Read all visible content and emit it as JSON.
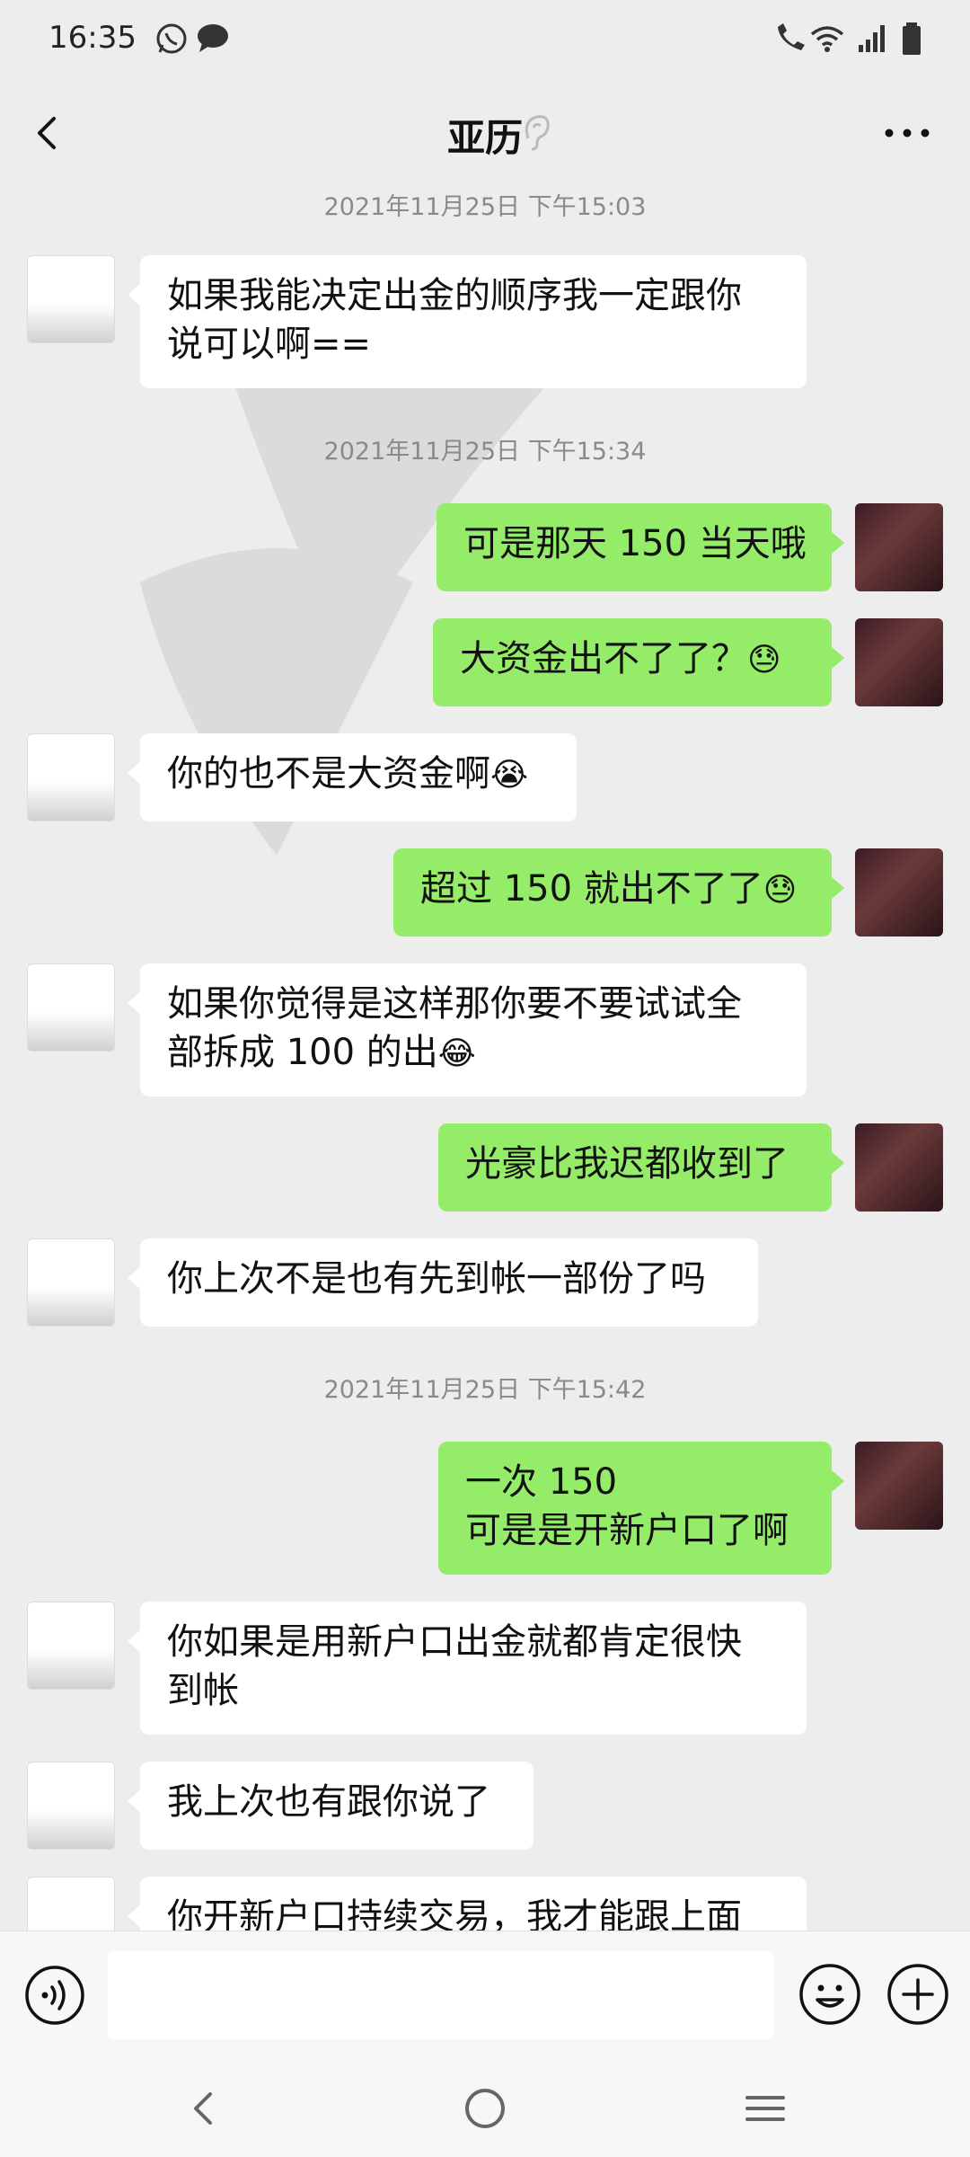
{
  "status": {
    "time": "16:35",
    "icons": [
      "whatsapp-icon",
      "message-icon",
      "wifi-call-icon",
      "wifi-icon",
      "signal-icon",
      "battery-icon"
    ]
  },
  "header": {
    "title": "亚历",
    "icons": [
      "back-icon",
      "ear-icon",
      "more-icon"
    ]
  },
  "timestamps": [
    "2021年11月25日 下午15:03",
    "2021年11月25日 下午15:34",
    "2021年11月25日 下午15:42"
  ],
  "messages": [
    {
      "side": "left",
      "lines": [
        "如果我能决定出金的顺序我一定跟你",
        "说可以啊=="
      ]
    },
    {
      "side": "right",
      "lines": [
        "可是那天 150 当天哦"
      ]
    },
    {
      "side": "right",
      "lines": [
        "大资金出不了了？"
      ],
      "emoji": "😓"
    },
    {
      "side": "left",
      "lines": [
        "你的也不是大资金啊"
      ],
      "emoji": "😭"
    },
    {
      "side": "right",
      "lines": [
        "超过 150 就出不了了"
      ],
      "emoji": "😓"
    },
    {
      "side": "left",
      "lines": [
        "如果你觉得是这样那你要不要试试全",
        "部拆成 100 的出"
      ],
      "emoji": "😂"
    },
    {
      "side": "right",
      "lines": [
        "光豪比我迟都收到了"
      ]
    },
    {
      "side": "left",
      "lines": [
        "你上次不是也有先到帐一部份了吗"
      ]
    },
    {
      "side": "right",
      "lines": [
        "一次 150",
        "可是是开新户口了啊"
      ]
    },
    {
      "side": "left",
      "lines": [
        "你如果是用新户口出金就都肯定很快",
        "到帐"
      ]
    },
    {
      "side": "left",
      "lines": [
        "我上次也有跟你说了"
      ]
    },
    {
      "side": "left",
      "lines": [
        "你开新户口持续交易，我才能跟上面"
      ]
    }
  ],
  "input": {
    "placeholder": ""
  },
  "colors": {
    "background": "#ededed",
    "bubble_sent": "#95ec69",
    "bubble_received": "#ffffff",
    "timestamp": "#8a8a8a"
  }
}
